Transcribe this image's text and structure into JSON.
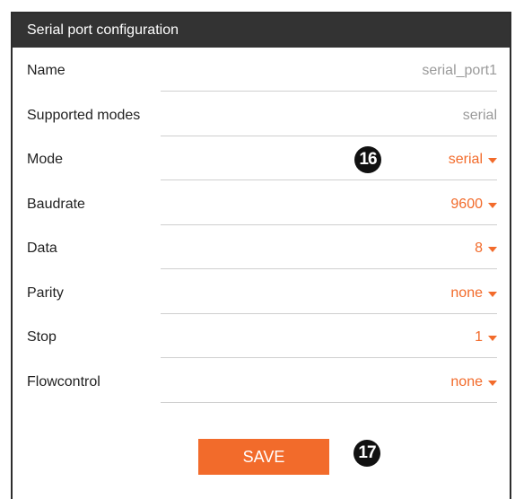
{
  "panel": {
    "title": "Serial port configuration"
  },
  "fields": {
    "name": {
      "label": "Name",
      "value": "serial_port1"
    },
    "supported_modes": {
      "label": "Supported modes",
      "value": "serial"
    },
    "mode": {
      "label": "Mode",
      "value": "serial"
    },
    "baudrate": {
      "label": "Baudrate",
      "value": "9600"
    },
    "data": {
      "label": "Data",
      "value": "8"
    },
    "parity": {
      "label": "Parity",
      "value": "none"
    },
    "stop": {
      "label": "Stop",
      "value": "1"
    },
    "flowcontrol": {
      "label": "Flowcontrol",
      "value": "none"
    }
  },
  "actions": {
    "save_label": "SAVE"
  },
  "callouts": {
    "mode": "16",
    "save": "17"
  },
  "colors": {
    "accent": "#f26b2b",
    "header_bg": "#333333",
    "readonly_text": "#9a9a9a"
  }
}
